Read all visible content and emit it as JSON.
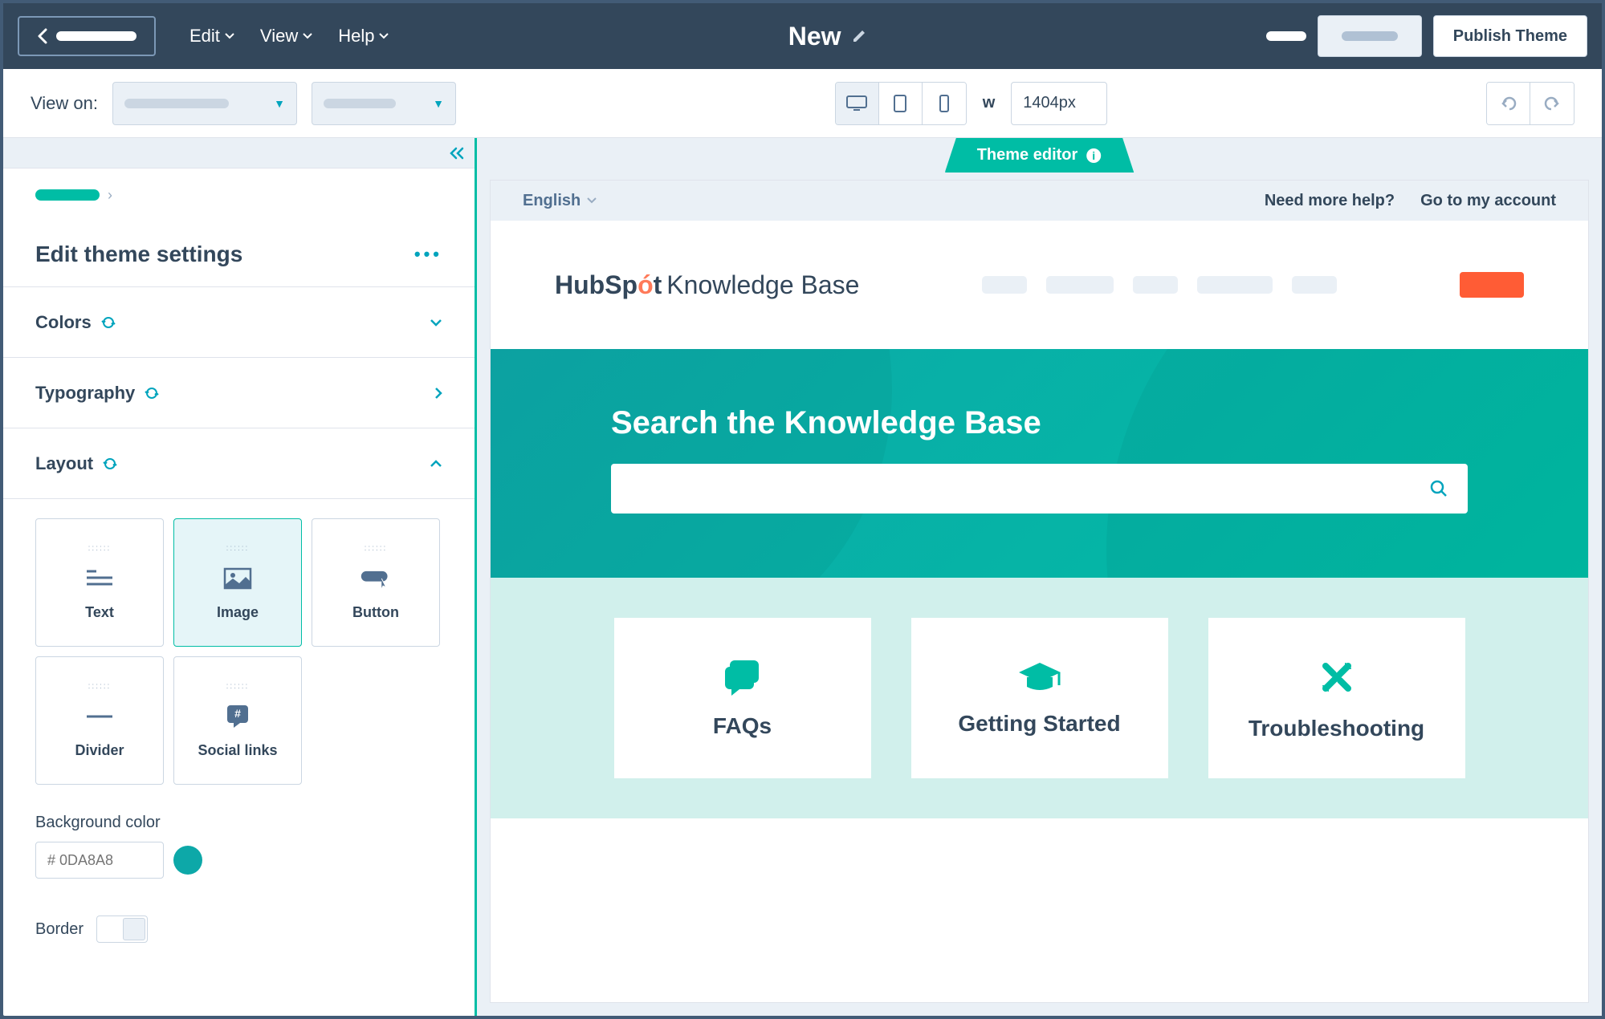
{
  "topbar": {
    "menu": {
      "edit": "Edit",
      "view": "View",
      "help": "Help"
    },
    "title": "New",
    "publish": "Publish Theme"
  },
  "subbar": {
    "view_on_label": "View on:",
    "width_label": "w",
    "width_value": "1404px"
  },
  "sidebar": {
    "title": "Edit theme settings",
    "sections": {
      "colors": "Colors",
      "typography": "Typography",
      "layout": "Layout"
    },
    "tiles": {
      "text": "Text",
      "image": "Image",
      "button": "Button",
      "divider": "Divider",
      "social": "Social links"
    },
    "bg_color_label": "Background color",
    "bg_color_value": "# 0DA8A8",
    "border_label": "Border"
  },
  "preview": {
    "theme_tab": "Theme editor",
    "kb": {
      "lang": "English",
      "help_link": "Need more help?",
      "account_link": "Go to my account",
      "logo_prefix": "HubSp",
      "logo_suffix": "t",
      "logo_rest": " Knowledge Base",
      "hero_title": "Search the Knowledge Base",
      "cards": {
        "faqs": "FAQs",
        "getting_started": "Getting Started",
        "troubleshooting": "Troubleshooting"
      }
    }
  }
}
